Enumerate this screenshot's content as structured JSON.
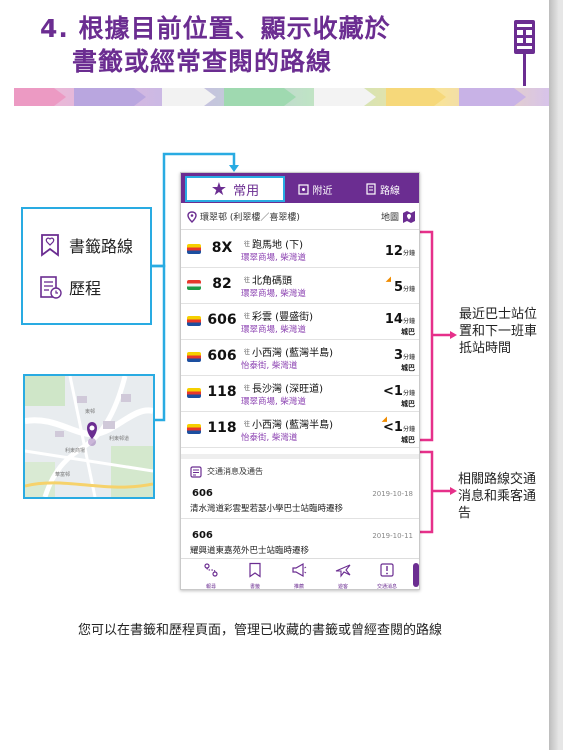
{
  "title": {
    "line1": "4. 根據目前位置、顯示收藏於",
    "line2": "書籤或經常查閱的路線"
  },
  "colors": {
    "purple": "#6b2d91",
    "cyan": "#29abe2",
    "pink": "#e6308a"
  },
  "callout": {
    "bookmark_label": "書籤路線",
    "history_label": "歷程"
  },
  "map_thumbnail": {
    "road_labels": [
      "利東商場",
      "東邨",
      "華富邨",
      "利東邨道"
    ]
  },
  "phone": {
    "tabs": {
      "favourite": "常用",
      "nearby": "附近",
      "route": "路線"
    },
    "location": {
      "name": "環翠邨 (利翠樓／喜翠樓)",
      "map_label": "地圖"
    },
    "to_prefix": "往",
    "eta_unit": "分鐘",
    "routes": [
      {
        "number": "8X",
        "destination": "跑馬地 (下)",
        "stop": "環翠商場, 柴灣道",
        "eta": "12",
        "operator": "",
        "flag": "ctb"
      },
      {
        "number": "82",
        "destination": "北角碼頭",
        "stop": "環翠商場, 柴灣道",
        "eta": "5",
        "operator": "",
        "flag": "kmb"
      },
      {
        "number": "606",
        "destination": "彩雲 (豐盛街)",
        "stop": "環翠商場, 柴灣道",
        "eta": "14",
        "operator": "城巴",
        "flag": "ctb"
      },
      {
        "number": "606",
        "destination": "小西灣 (藍灣半島)",
        "stop": "怡泰街, 柴灣道",
        "eta": "3",
        "operator": "城巴",
        "flag": "ctb"
      },
      {
        "number": "118",
        "destination": "長沙灣 (深旺道)",
        "stop": "環翠商場, 柴灣道",
        "eta": "<1",
        "operator": "城巴",
        "flag": "ctb"
      },
      {
        "number": "118",
        "destination": "小西灣 (藍灣半島)",
        "stop": "怡泰街, 柴灣道",
        "eta": "<1",
        "operator": "城巴",
        "flag": "ctb"
      }
    ],
    "notices_title": "交通消息及通告",
    "notices": [
      {
        "route": "606",
        "date": "2019-10-18",
        "message": "清水灣道彩雲聖若瑟小學巴士站臨時遷移"
      },
      {
        "route": "606",
        "date": "2019-10-11",
        "message": "耀興道東嘉苑外巴士站臨時遷移"
      }
    ],
    "bottom_nav": [
      "報尋",
      "書籤",
      "推薦",
      "遊客",
      "交通消息"
    ]
  },
  "captions": {
    "eta_note": "最近巴士站位置和下一班車抵站時間",
    "notice_note": "相關路線交通消息和乘客通告"
  },
  "footer": "您可以在書籤和歷程頁面，管理已收藏的書籤或曾經查閱的路線"
}
